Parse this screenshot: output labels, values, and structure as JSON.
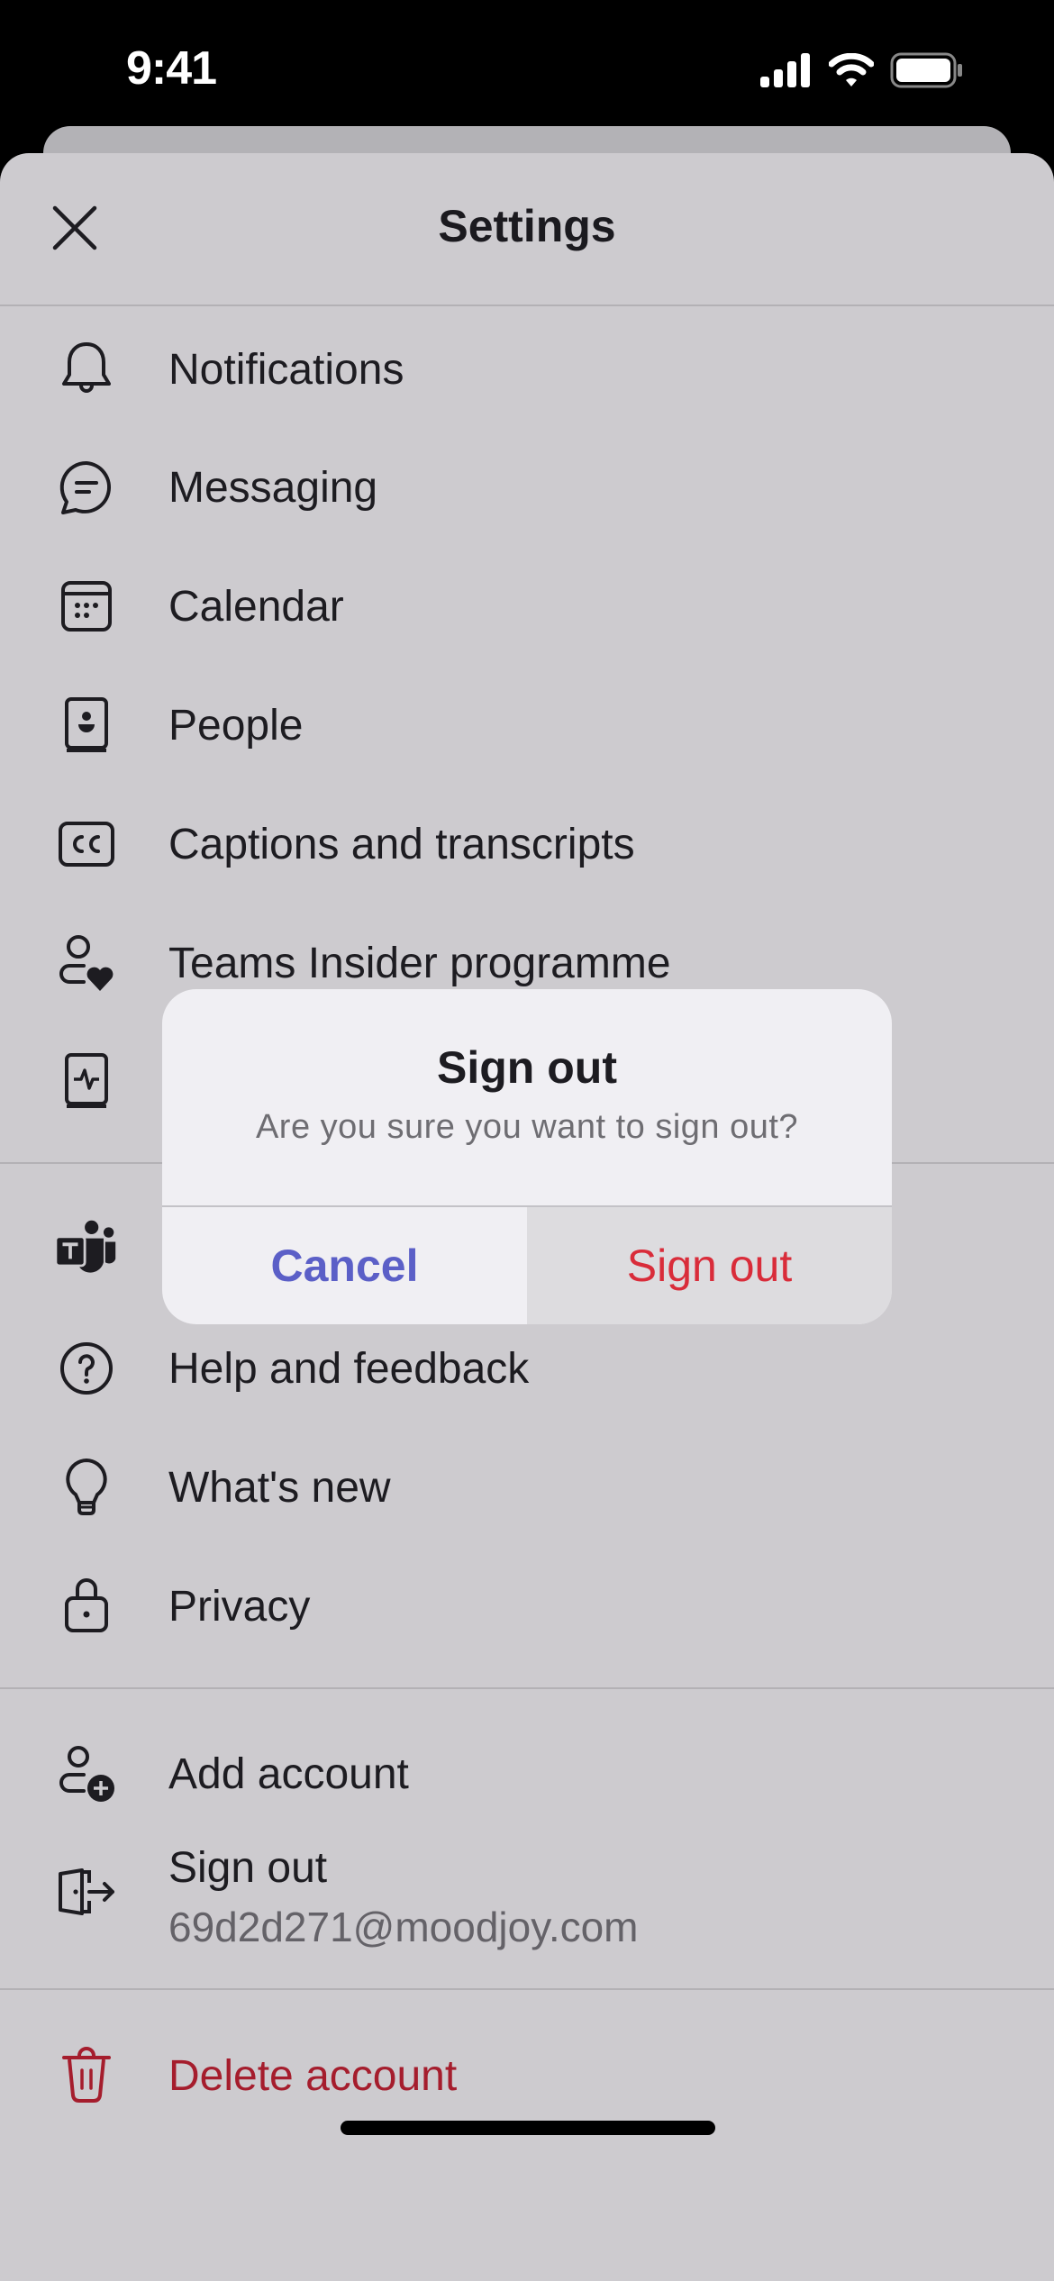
{
  "status_bar": {
    "time": "9:41",
    "icons": [
      "cellular-signal-icon",
      "wifi-icon",
      "battery-icon"
    ]
  },
  "header": {
    "title": "Settings",
    "close_icon": "close-icon"
  },
  "sections": [
    {
      "items": [
        {
          "label": "Notifications",
          "icon": "bell-icon"
        },
        {
          "label": "Messaging",
          "icon": "chat-bubble-icon"
        },
        {
          "label": "Calendar",
          "icon": "calendar-icon"
        },
        {
          "label": "People",
          "icon": "contact-book-icon"
        },
        {
          "label": "Captions and transcripts",
          "icon": "closed-captions-icon"
        },
        {
          "label": "Teams Insider programme",
          "icon": "person-heart-icon"
        },
        {
          "label": "",
          "icon": "book-pulse-icon"
        }
      ]
    },
    {
      "items": [
        {
          "label": "",
          "icon": "teams-logo-icon"
        },
        {
          "label": "Help and feedback",
          "icon": "question-circle-icon"
        },
        {
          "label": "What's new",
          "icon": "lightbulb-icon"
        },
        {
          "label": "Privacy",
          "icon": "lock-icon"
        }
      ]
    },
    {
      "items": [
        {
          "label": "Add account",
          "icon": "person-add-icon"
        },
        {
          "label": "Sign out",
          "sublabel": "69d2d271@moodjoy.com",
          "icon": "sign-out-door-icon"
        }
      ]
    },
    {
      "items": [
        {
          "label": "Delete account",
          "icon": "trash-icon",
          "color": "#a51d2d"
        }
      ]
    }
  ],
  "dialog": {
    "title": "Sign out",
    "message": "Are you sure you want to sign out?",
    "cancel_label": "Cancel",
    "confirm_label": "Sign out",
    "cancel_color": "#5b5fc7",
    "confirm_color": "#d92c3a"
  },
  "colors": {
    "background": "#cdcbcf",
    "dialog_background": "#f0eff3",
    "danger": "#a51d2d"
  }
}
